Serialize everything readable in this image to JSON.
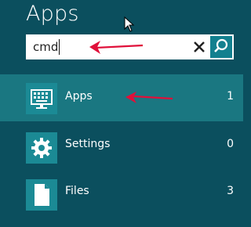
{
  "header": {
    "title": "Apps"
  },
  "search": {
    "value": "cmd"
  },
  "results": [
    {
      "label": "Apps",
      "count": "1",
      "icon": "keyboard-monitor-icon",
      "selected": true
    },
    {
      "label": "Settings",
      "count": "0",
      "icon": "gear-icon",
      "selected": false
    },
    {
      "label": "Files",
      "count": "3",
      "icon": "file-icon",
      "selected": false
    }
  ],
  "colors": {
    "background": "#0b4f5e",
    "selected_row": "#1a7781",
    "tile": "#1b8a95",
    "search_button": "#12808f",
    "annotation_arrow": "#e0103a"
  }
}
